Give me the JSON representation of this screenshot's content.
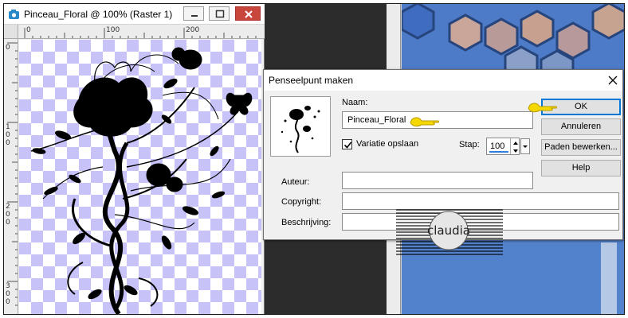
{
  "document": {
    "title": "Pinceau_Floral @ 100% (Raster 1)",
    "ruler_labels": [
      "0",
      "100",
      "200"
    ],
    "ruler_v_labels": [
      "0",
      "1",
      "0",
      "0",
      "2",
      "0",
      "0",
      "3",
      "0",
      "0"
    ]
  },
  "dialog": {
    "title": "Penseelpunt maken",
    "name_label": "Naam:",
    "name_value": "Pinceau_Floral",
    "save_variation_label": "Variatie opslaan",
    "save_variation_checked": true,
    "step_label": "Stap:",
    "step_value": "100",
    "author_label": "Auteur:",
    "author_value": "",
    "copyright_label": "Copyright:",
    "copyright_value": "",
    "description_label": "Beschrijving:",
    "description_value": "",
    "buttons": {
      "ok": "OK",
      "cancel": "Annuleren",
      "edit_paths": "Paden bewerken...",
      "help": "Help"
    }
  },
  "watermark": {
    "text": "claudia"
  },
  "colors": {
    "checker": "#c7c2f8",
    "accent": "#0078d7",
    "pointer": "#f5d800",
    "close_red": "#c9463d"
  },
  "icons": [
    "app-icon",
    "minimize-icon",
    "maximize-icon",
    "close-icon",
    "checkmark-icon",
    "pointing-hand-icon",
    "spin-up-icon",
    "spin-down-icon"
  ]
}
